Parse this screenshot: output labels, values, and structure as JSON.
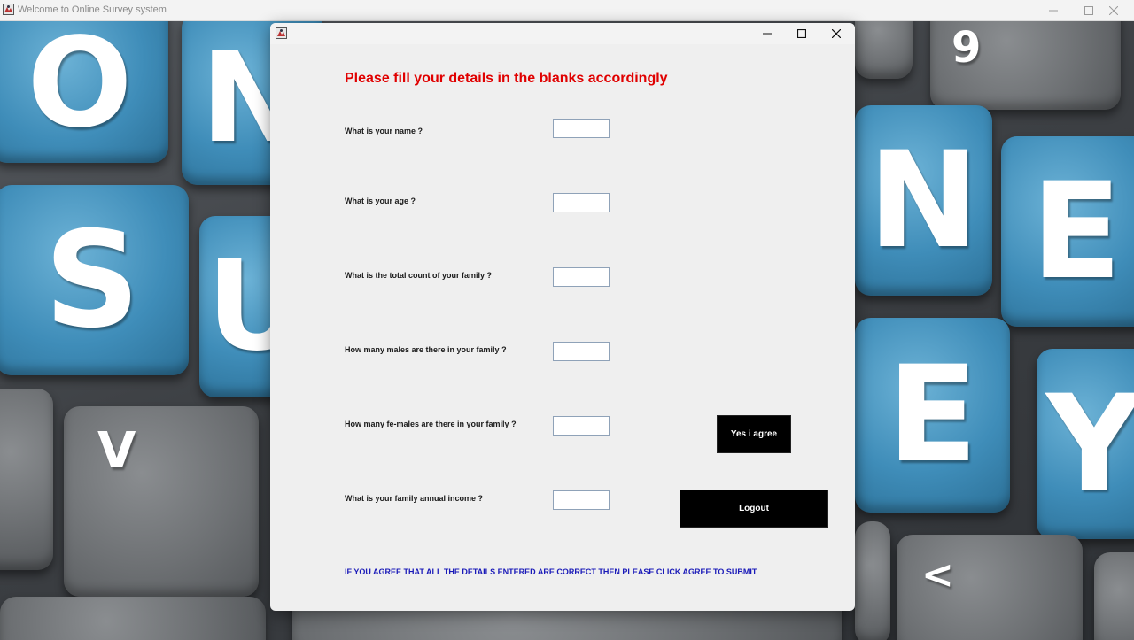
{
  "window": {
    "title": "Welcome to Online Survey system"
  },
  "background": {
    "keys": [
      "O",
      "N",
      "S",
      "U",
      "V",
      "9",
      "N",
      "E",
      "E",
      "Y",
      "<"
    ]
  },
  "form": {
    "heading": "Please fill your details in the blanks accordingly",
    "questions": [
      {
        "label": "What is your name ?",
        "value": ""
      },
      {
        "label": "What is your age ?",
        "value": ""
      },
      {
        "label": "What is the total count of your family ?",
        "value": ""
      },
      {
        "label": "How many males are there in your family ?",
        "value": ""
      },
      {
        "label": "How many fe-males are there in your family ?",
        "value": ""
      },
      {
        "label": "What is your family annual income ?",
        "value": ""
      }
    ],
    "agree_label": "Yes i agree",
    "logout_label": "Logout",
    "footer_note": "IF YOU AGREE THAT ALL THE DETAILS ENTERED ARE CORRECT THEN PLEASE CLICK AGREE TO SUBMIT"
  },
  "colors": {
    "heading": "#e00000",
    "footer_note": "#1a1ab8",
    "button_bg": "#000000",
    "button_text": "#ffffff"
  },
  "icons": {
    "app": "java-app-icon",
    "minimize": "minimize-icon",
    "maximize": "maximize-icon",
    "close": "close-icon"
  }
}
